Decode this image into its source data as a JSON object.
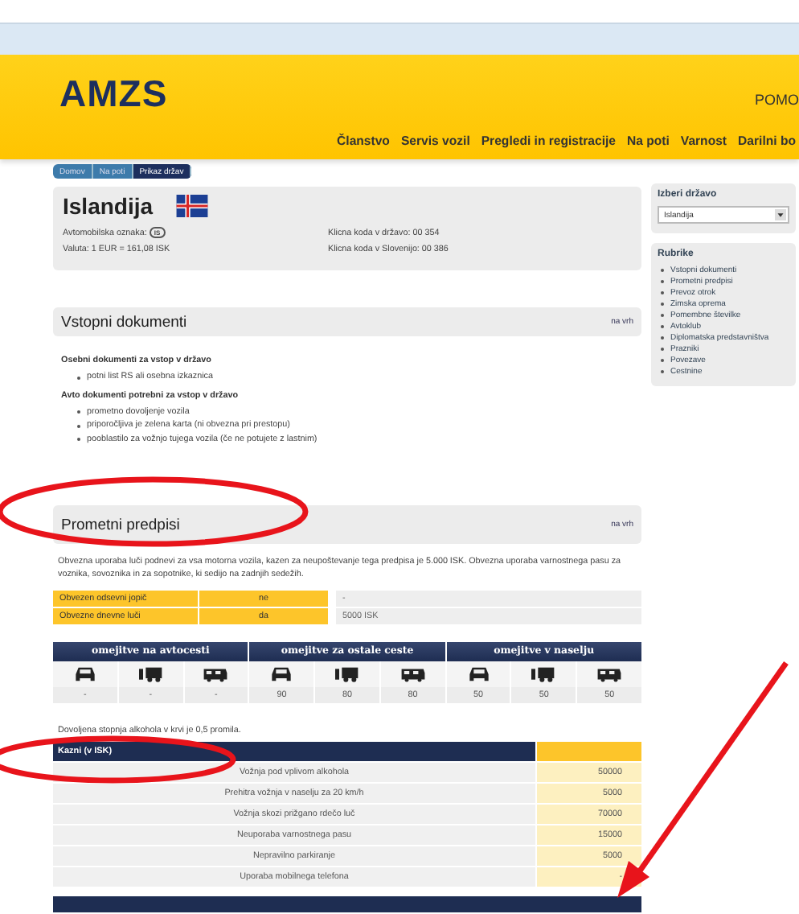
{
  "header": {
    "logo": "AMZS",
    "help_link": "POMO",
    "nav": [
      {
        "label": "Članstvo",
        "selected": false
      },
      {
        "label": "Servis vozil",
        "selected": false
      },
      {
        "label": "Pregledi in registracije",
        "selected": false
      },
      {
        "label": "Na poti",
        "selected": false
      },
      {
        "label": "Varnost",
        "selected": false
      },
      {
        "label": "Darilni bo",
        "selected": false
      }
    ]
  },
  "breadcrumb": [
    {
      "label": "Domov",
      "selected": false
    },
    {
      "label": "Na poti",
      "selected": false
    },
    {
      "label": "Prikaz držav",
      "selected": true
    }
  ],
  "country": {
    "name": "Islandija",
    "plate_label": "Avtomobilska oznaka:",
    "plate": "IS",
    "currency": "Valuta: 1 EUR = 161,08 ISK",
    "dial_in": "Klicna koda v državo: 00 354",
    "dial_home": "Klicna koda v Slovenijo: 00 386"
  },
  "entry": {
    "title": "Vstopni dokumenti",
    "top_link": "na vrh",
    "groups": [
      {
        "heading": "Osebni dokumenti za vstop v državo",
        "items": [
          "potni list RS ali osebna izkaznica"
        ]
      },
      {
        "heading": "Avto dokumenti potrebni za vstop v državo",
        "items": [
          "prometno dovoljenje vozila",
          "priporočljiva je zelena karta (ni obvezna pri prestopu)",
          "pooblastilo za vožnjo tujega vozila (če ne potujete z lastnim)"
        ]
      }
    ]
  },
  "rules": {
    "title": "Prometni predpisi",
    "top_link": "na vrh",
    "text": "Obvezna uporaba luči podnevi za vsa motorna vozila, kazen za neupoštevanje tega predpisa je 5.000 ISK. Obvezna uporaba varnostnega pasu za voznika, sovoznika in za sopotnike, ki sedijo na zadnjih sedežih.",
    "requirements": [
      {
        "label": "Obvezen odsevni jopič",
        "value": "ne",
        "fine": "-"
      },
      {
        "label": "Obvezne dnevne luči",
        "value": "da",
        "fine": "5000 ISK"
      }
    ],
    "speed_groups": [
      "omejitve na avtocesti",
      "omejitve za ostale ceste",
      "omejitve v naselju"
    ],
    "speed_columns": [
      {
        "kind": "car",
        "limit": "-"
      },
      {
        "kind": "truck",
        "limit": "-"
      },
      {
        "kind": "camper",
        "limit": "-"
      },
      {
        "kind": "car",
        "limit": "90"
      },
      {
        "kind": "truck",
        "limit": "80"
      },
      {
        "kind": "camper",
        "limit": "80"
      },
      {
        "kind": "car",
        "limit": "50"
      },
      {
        "kind": "truck",
        "limit": "50"
      },
      {
        "kind": "camper",
        "limit": "50"
      }
    ],
    "alcohol": "Dovoljena stopnja alkohola v krvi je 0,5 promila.",
    "fines_title": "Kazni (v ISK)",
    "fines": [
      {
        "offence": "Vožnja pod vplivom alkohola",
        "amount": "50000"
      },
      {
        "offence": "Prehitra vožnja v naselju za 20 km/h",
        "amount": "5000"
      },
      {
        "offence": "Vožnja skozi prižgano rdečo luč",
        "amount": "70000"
      },
      {
        "offence": "Neuporaba varnostnega pasu",
        "amount": "15000"
      },
      {
        "offence": "Nepravilno parkiranje",
        "amount": "5000"
      },
      {
        "offence": "Uporaba mobilnega telefona",
        "amount": "-"
      }
    ]
  },
  "sidebar": {
    "select_title": "Izberi državo",
    "select_value": "Islandija",
    "rubrics_title": "Rubrike",
    "rubrics": [
      "Vstopni dokumenti",
      "Prometni predpisi",
      "Prevoz otrok",
      "Zimska oprema",
      "Pomembne številke",
      "Avtoklub",
      "Diplomatska predstavništva",
      "Prazniki",
      "Povezave",
      "Cestnine"
    ]
  }
}
